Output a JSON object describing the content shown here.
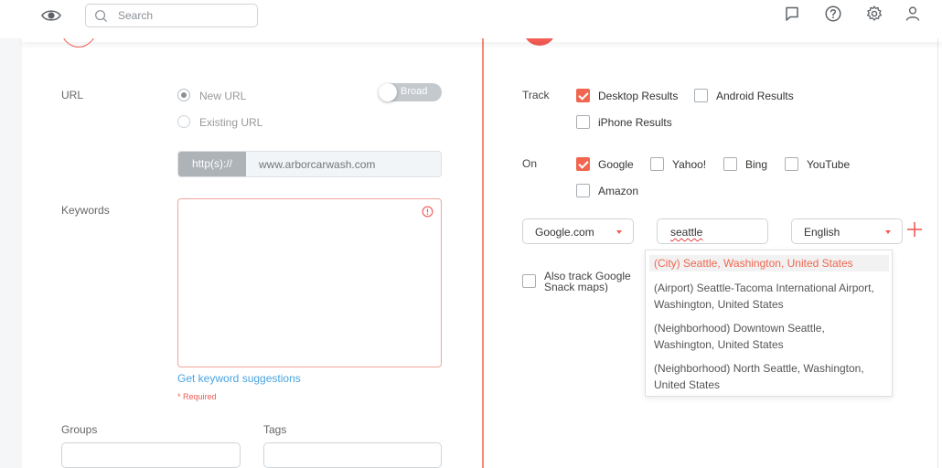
{
  "header": {
    "search_placeholder": "Search",
    "icons": [
      "eye-icon",
      "search-icon",
      "chat-icon",
      "help-icon",
      "settings-icon",
      "user-icon"
    ]
  },
  "left": {
    "url_label": "URL",
    "url_options": [
      "New URL",
      "Existing URL"
    ],
    "selected_url_option": "New URL",
    "toggle_label": "Broad",
    "url_prefix": "http(s)://",
    "url_placeholder": "www.arborcarwash.com",
    "keywords_label": "Keywords",
    "keyword_suggestions_link": "Get keyword suggestions",
    "required_text": "* Required",
    "groups_label": "Groups",
    "tags_label": "Tags"
  },
  "right": {
    "track_label": "Track",
    "track_options": [
      {
        "label": "Desktop Results",
        "checked": true
      },
      {
        "label": "Android Results",
        "checked": false
      },
      {
        "label": "iPhone Results",
        "checked": false
      }
    ],
    "on_label": "On",
    "engine_options": [
      {
        "label": "Google",
        "checked": true
      },
      {
        "label": "Yahoo!",
        "checked": false
      },
      {
        "label": "Bing",
        "checked": false
      },
      {
        "label": "YouTube",
        "checked": false
      },
      {
        "label": "Amazon",
        "checked": false
      }
    ],
    "domain_select": "Google.com",
    "location_value": "seattle",
    "language_select": "English",
    "also_track_text": "Also track Google Snack maps)",
    "location_suggestions": [
      "(City) Seattle, Washington, United States",
      "(Airport) Seattle-Tacoma International Airport, Washington, United States",
      "(Neighborhood) Downtown Seattle, Washington, United States",
      "(Neighborhood) North Seattle, Washington, United States"
    ]
  },
  "colors": {
    "accent": "#f0664f",
    "link": "#4aa3df",
    "divider": "#f08a78"
  }
}
